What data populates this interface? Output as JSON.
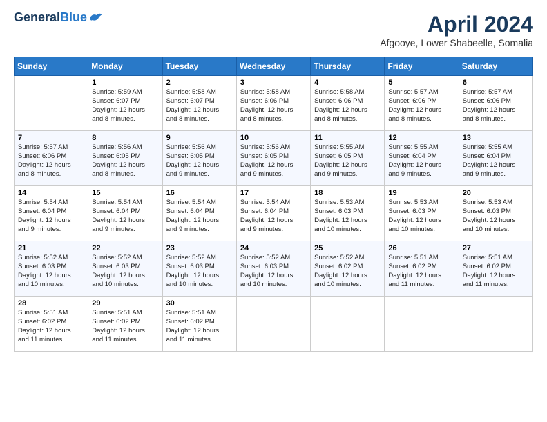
{
  "header": {
    "logo_line1": "General",
    "logo_line2": "Blue",
    "month": "April 2024",
    "location": "Afgooye, Lower Shabeelle, Somalia"
  },
  "days_of_week": [
    "Sunday",
    "Monday",
    "Tuesday",
    "Wednesday",
    "Thursday",
    "Friday",
    "Saturday"
  ],
  "weeks": [
    [
      {
        "day": "",
        "info": ""
      },
      {
        "day": "1",
        "info": "Sunrise: 5:59 AM\nSunset: 6:07 PM\nDaylight: 12 hours\nand 8 minutes."
      },
      {
        "day": "2",
        "info": "Sunrise: 5:58 AM\nSunset: 6:07 PM\nDaylight: 12 hours\nand 8 minutes."
      },
      {
        "day": "3",
        "info": "Sunrise: 5:58 AM\nSunset: 6:06 PM\nDaylight: 12 hours\nand 8 minutes."
      },
      {
        "day": "4",
        "info": "Sunrise: 5:58 AM\nSunset: 6:06 PM\nDaylight: 12 hours\nand 8 minutes."
      },
      {
        "day": "5",
        "info": "Sunrise: 5:57 AM\nSunset: 6:06 PM\nDaylight: 12 hours\nand 8 minutes."
      },
      {
        "day": "6",
        "info": "Sunrise: 5:57 AM\nSunset: 6:06 PM\nDaylight: 12 hours\nand 8 minutes."
      }
    ],
    [
      {
        "day": "7",
        "info": "Sunrise: 5:57 AM\nSunset: 6:06 PM\nDaylight: 12 hours\nand 8 minutes."
      },
      {
        "day": "8",
        "info": "Sunrise: 5:56 AM\nSunset: 6:05 PM\nDaylight: 12 hours\nand 8 minutes."
      },
      {
        "day": "9",
        "info": "Sunrise: 5:56 AM\nSunset: 6:05 PM\nDaylight: 12 hours\nand 9 minutes."
      },
      {
        "day": "10",
        "info": "Sunrise: 5:56 AM\nSunset: 6:05 PM\nDaylight: 12 hours\nand 9 minutes."
      },
      {
        "day": "11",
        "info": "Sunrise: 5:55 AM\nSunset: 6:05 PM\nDaylight: 12 hours\nand 9 minutes."
      },
      {
        "day": "12",
        "info": "Sunrise: 5:55 AM\nSunset: 6:04 PM\nDaylight: 12 hours\nand 9 minutes."
      },
      {
        "day": "13",
        "info": "Sunrise: 5:55 AM\nSunset: 6:04 PM\nDaylight: 12 hours\nand 9 minutes."
      }
    ],
    [
      {
        "day": "14",
        "info": "Sunrise: 5:54 AM\nSunset: 6:04 PM\nDaylight: 12 hours\nand 9 minutes."
      },
      {
        "day": "15",
        "info": "Sunrise: 5:54 AM\nSunset: 6:04 PM\nDaylight: 12 hours\nand 9 minutes."
      },
      {
        "day": "16",
        "info": "Sunrise: 5:54 AM\nSunset: 6:04 PM\nDaylight: 12 hours\nand 9 minutes."
      },
      {
        "day": "17",
        "info": "Sunrise: 5:54 AM\nSunset: 6:04 PM\nDaylight: 12 hours\nand 9 minutes."
      },
      {
        "day": "18",
        "info": "Sunrise: 5:53 AM\nSunset: 6:03 PM\nDaylight: 12 hours\nand 10 minutes."
      },
      {
        "day": "19",
        "info": "Sunrise: 5:53 AM\nSunset: 6:03 PM\nDaylight: 12 hours\nand 10 minutes."
      },
      {
        "day": "20",
        "info": "Sunrise: 5:53 AM\nSunset: 6:03 PM\nDaylight: 12 hours\nand 10 minutes."
      }
    ],
    [
      {
        "day": "21",
        "info": "Sunrise: 5:52 AM\nSunset: 6:03 PM\nDaylight: 12 hours\nand 10 minutes."
      },
      {
        "day": "22",
        "info": "Sunrise: 5:52 AM\nSunset: 6:03 PM\nDaylight: 12 hours\nand 10 minutes."
      },
      {
        "day": "23",
        "info": "Sunrise: 5:52 AM\nSunset: 6:03 PM\nDaylight: 12 hours\nand 10 minutes."
      },
      {
        "day": "24",
        "info": "Sunrise: 5:52 AM\nSunset: 6:03 PM\nDaylight: 12 hours\nand 10 minutes."
      },
      {
        "day": "25",
        "info": "Sunrise: 5:52 AM\nSunset: 6:02 PM\nDaylight: 12 hours\nand 10 minutes."
      },
      {
        "day": "26",
        "info": "Sunrise: 5:51 AM\nSunset: 6:02 PM\nDaylight: 12 hours\nand 11 minutes."
      },
      {
        "day": "27",
        "info": "Sunrise: 5:51 AM\nSunset: 6:02 PM\nDaylight: 12 hours\nand 11 minutes."
      }
    ],
    [
      {
        "day": "28",
        "info": "Sunrise: 5:51 AM\nSunset: 6:02 PM\nDaylight: 12 hours\nand 11 minutes."
      },
      {
        "day": "29",
        "info": "Sunrise: 5:51 AM\nSunset: 6:02 PM\nDaylight: 12 hours\nand 11 minutes."
      },
      {
        "day": "30",
        "info": "Sunrise: 5:51 AM\nSunset: 6:02 PM\nDaylight: 12 hours\nand 11 minutes."
      },
      {
        "day": "",
        "info": ""
      },
      {
        "day": "",
        "info": ""
      },
      {
        "day": "",
        "info": ""
      },
      {
        "day": "",
        "info": ""
      }
    ]
  ]
}
